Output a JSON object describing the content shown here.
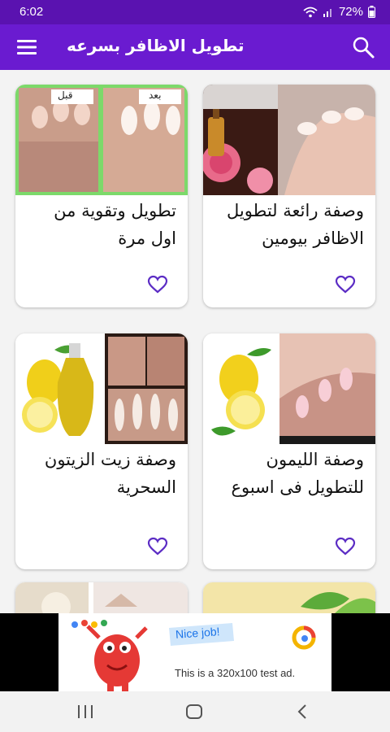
{
  "status_bar": {
    "time": "6:02",
    "battery": "72%"
  },
  "app_bar": {
    "title": "تطويل الاظافر بسرعه"
  },
  "cards": [
    {
      "title": "وصفة رائعة لتطويل الاظافر بيومين",
      "favorite_icon": "heart-outline-icon"
    },
    {
      "title": "تطويل وتقوية من اول مرة",
      "favorite_icon": "heart-outline-icon",
      "image_labels": {
        "before": "قبل",
        "after": "بعد"
      }
    },
    {
      "title": "وصفة الليمون للتطويل فى اسبوع",
      "favorite_icon": "heart-outline-icon"
    },
    {
      "title": "وصفة زيت الزيتون السحرية",
      "favorite_icon": "heart-outline-icon"
    }
  ],
  "ad": {
    "badge": "Nice job!",
    "text": "This is a 320x100 test ad."
  },
  "nav_bar": {
    "icons": [
      "recent-apps-icon",
      "home-icon",
      "back-icon"
    ]
  },
  "colors": {
    "status_bar": "#5a12b0",
    "app_bar": "#6a1bd0",
    "heart": "#5b2cc4"
  }
}
